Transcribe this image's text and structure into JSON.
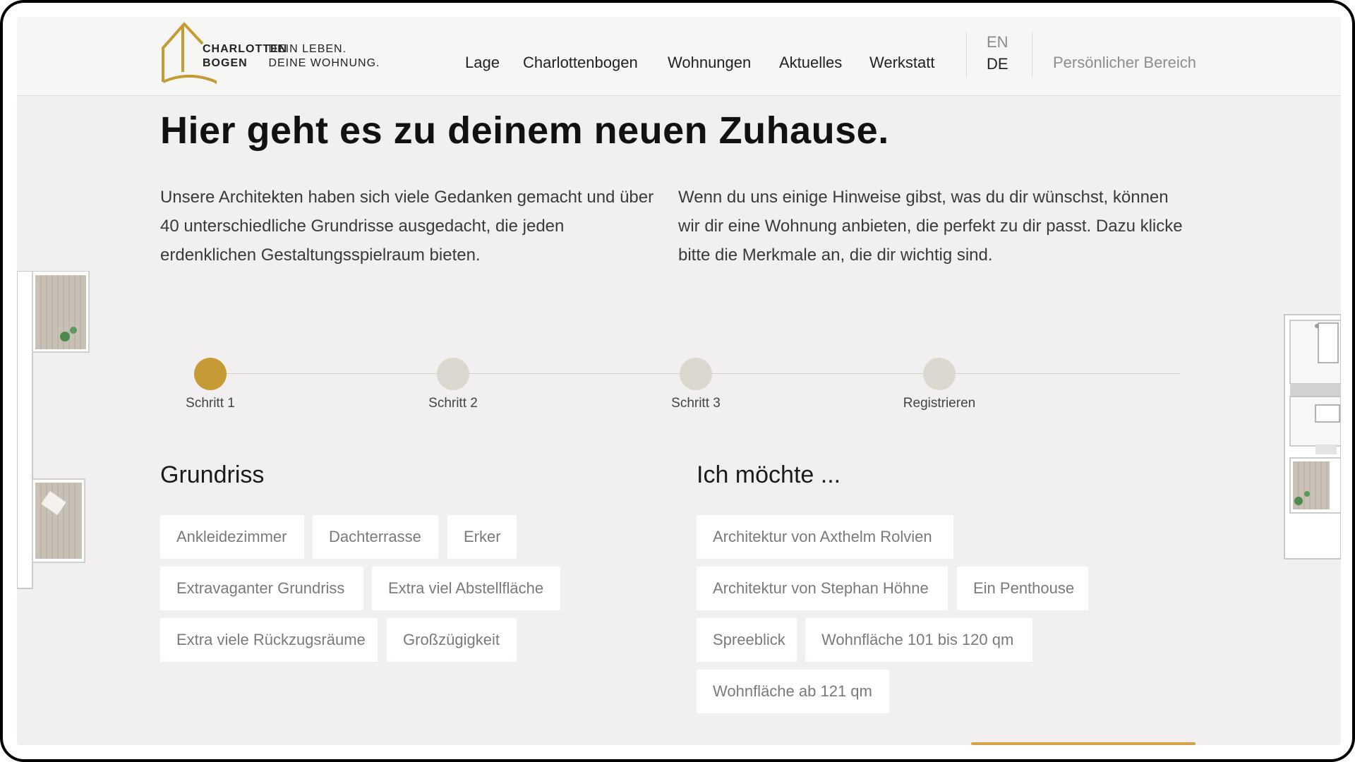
{
  "brand": {
    "name_line1": "CHARLOTTEN",
    "name_line2": "BOGEN",
    "tagline1": "DEIN LEBEN.",
    "tagline2": "DEINE WOHNUNG.",
    "accent_color": "#c69a35"
  },
  "nav": {
    "items": [
      {
        "label": "Lage"
      },
      {
        "label": "Charlottenbogen"
      },
      {
        "label": "Wohnungen"
      },
      {
        "label": "Aktuelles"
      },
      {
        "label": "Werkstatt"
      }
    ],
    "lang_en": "EN",
    "lang_de": "DE",
    "personal": "Persönlicher Bereich"
  },
  "hero": {
    "title": "Hier geht es zu deinem neuen Zuhause.",
    "intro_left": "Unsere Architekten haben sich viele Gedanken gemacht und über 40 unterschiedliche Grundrisse ausgedacht, die jeden erdenklichen Gestaltungsspielraum bieten.",
    "intro_right": "Wenn du uns einige Hinweise gibst, was du dir wünschst, können wir dir eine Wohnung anbieten, die perfekt zu dir passt. Dazu klicke bitte die Merkmale an, die dir wichtig sind."
  },
  "steps": [
    {
      "label": "Schritt 1",
      "active": true
    },
    {
      "label": "Schritt 2",
      "active": false
    },
    {
      "label": "Schritt 3",
      "active": false
    },
    {
      "label": "Registrieren",
      "active": false
    }
  ],
  "grundriss": {
    "title": "Grundriss",
    "tags": [
      "Ankleidezimmer",
      "Dachterrasse",
      "Erker",
      "Extravaganter Grundriss",
      "Extra viel Abstellfläche",
      "Extra viele Rückzugsräume",
      "Großzügigkeit"
    ]
  },
  "wishes": {
    "title": "Ich möchte ...",
    "tags": [
      "Architektur von Axthelm Rolvien",
      "Architektur von Stephan Höhne",
      "Ein Penthouse",
      "Spreeblick",
      "Wohnfläche 101 bis 120 qm",
      "Wohnfläche ab 121 qm"
    ]
  }
}
